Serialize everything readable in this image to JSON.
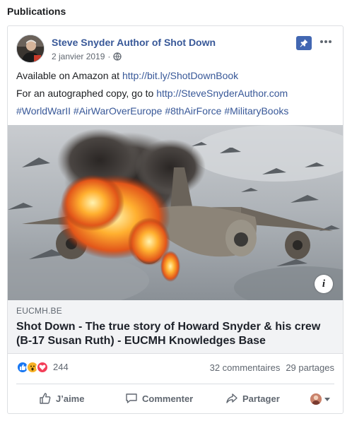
{
  "section": {
    "title": "Publications"
  },
  "post": {
    "author": "Steve Snyder Author of Shot Down",
    "date": "2 janvier 2019",
    "dot": "·",
    "lines": {
      "line1_prefix": "Available on Amazon at ",
      "line1_link": "http://bit.ly/ShotDownBook",
      "line2_prefix": "For an autographed copy, go to ",
      "line2_link": "http://SteveSnyderAuthor.com",
      "hashtags": "#WorldWarII #AirWarOverEurope #8thAirForce #MilitaryBooks"
    }
  },
  "link_preview": {
    "domain": "EUCMH.BE",
    "title": "Shot Down - The true story of Howard Snyder & his crew (B-17 Susan Ruth) - EUCMH Knowledges Base",
    "info_glyph": "i"
  },
  "stats": {
    "reaction_count": "244",
    "comments": "32 commentaires",
    "shares": "29 partages"
  },
  "actions": {
    "like": "J’aime",
    "comment": "Commenter",
    "share": "Partager"
  },
  "colors": {
    "link": "#385898",
    "like_blue": "#1877f2",
    "wow_yellow": "#f7b125",
    "love_red": "#f33e58",
    "pin_blue": "#4267b2"
  }
}
